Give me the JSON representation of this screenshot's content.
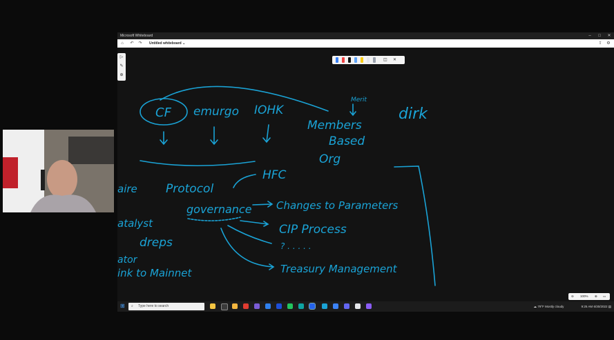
{
  "window": {
    "title": "Microsoft Whiteboard",
    "controls": [
      "–",
      "□",
      "✕"
    ]
  },
  "toolbar": {
    "doc_name": "Untitled whiteboard",
    "doc_chevron": "⌄"
  },
  "zoom": {
    "level": "100%"
  },
  "ink_text": {
    "cf": "CF",
    "emurgo": "emurgo",
    "iohk": "IOHK",
    "merit": "Merit",
    "members": "Members",
    "based": "Based",
    "org": "Org",
    "dirk": "dirk",
    "protocol": "Protocol",
    "hfc": "HFC",
    "governance": "governance",
    "changes": "Changes to Parameters",
    "cip": "CIP Process",
    "dots": "? . . . . .",
    "treasury": "Treasury Management",
    "aire": "aire",
    "atalyst": "atalyst",
    "dreps": "dreps",
    "ator": "ator",
    "ink_mainnet": "ink to Mainnet"
  },
  "taskbar": {
    "search_placeholder": "Type here to search",
    "weather": "79°F Mostly cloudy",
    "time": "9:25 AM",
    "date": "6/30/2022"
  },
  "colors": {
    "ink": "#1aa3d6",
    "canvas": "#131313",
    "pens": [
      "#3b82f6",
      "#ef4444",
      "#111111",
      "#60a5fa",
      "#facc15",
      "#e5e7eb",
      "#9ca3af"
    ]
  }
}
